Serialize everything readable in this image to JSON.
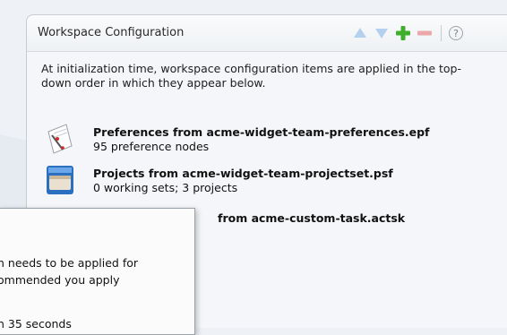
{
  "panel": {
    "title": "Workspace Configuration",
    "intro": "At initialization time, workspace configuration items are applied in the top-down order in which they appear below.",
    "toolbar": [
      {
        "icon": "move-up-icon",
        "label": "Move Up"
      },
      {
        "icon": "move-down-icon",
        "label": "Move Down"
      },
      {
        "icon": "add-icon",
        "label": "Add"
      },
      {
        "icon": "remove-icon",
        "label": "Remove"
      },
      {
        "icon": "help-icon",
        "label": "Help"
      }
    ],
    "items": [
      {
        "icon": "preferences-icon",
        "title": "Preferences from acme-widget-team-preferences.epf",
        "subtitle": "95 preference nodes"
      },
      {
        "icon": "projects-icon",
        "title": "Projects from acme-widget-team-projectset.psf",
        "subtitle": "0 working sets; 3 projects"
      },
      {
        "icon": "custom-task-icon",
        "title": "from acme-custom-task.actsk",
        "subtitle": ""
      }
    ]
  },
  "popup": {
    "lines": [
      "n needs to be applied for",
      "ommended you apply",
      "n 35 seconds"
    ]
  },
  "colors": {
    "accent_green": "#3fae2a",
    "disabled_blue": "#a9c8ec",
    "disabled_red": "#e8a3a3"
  }
}
